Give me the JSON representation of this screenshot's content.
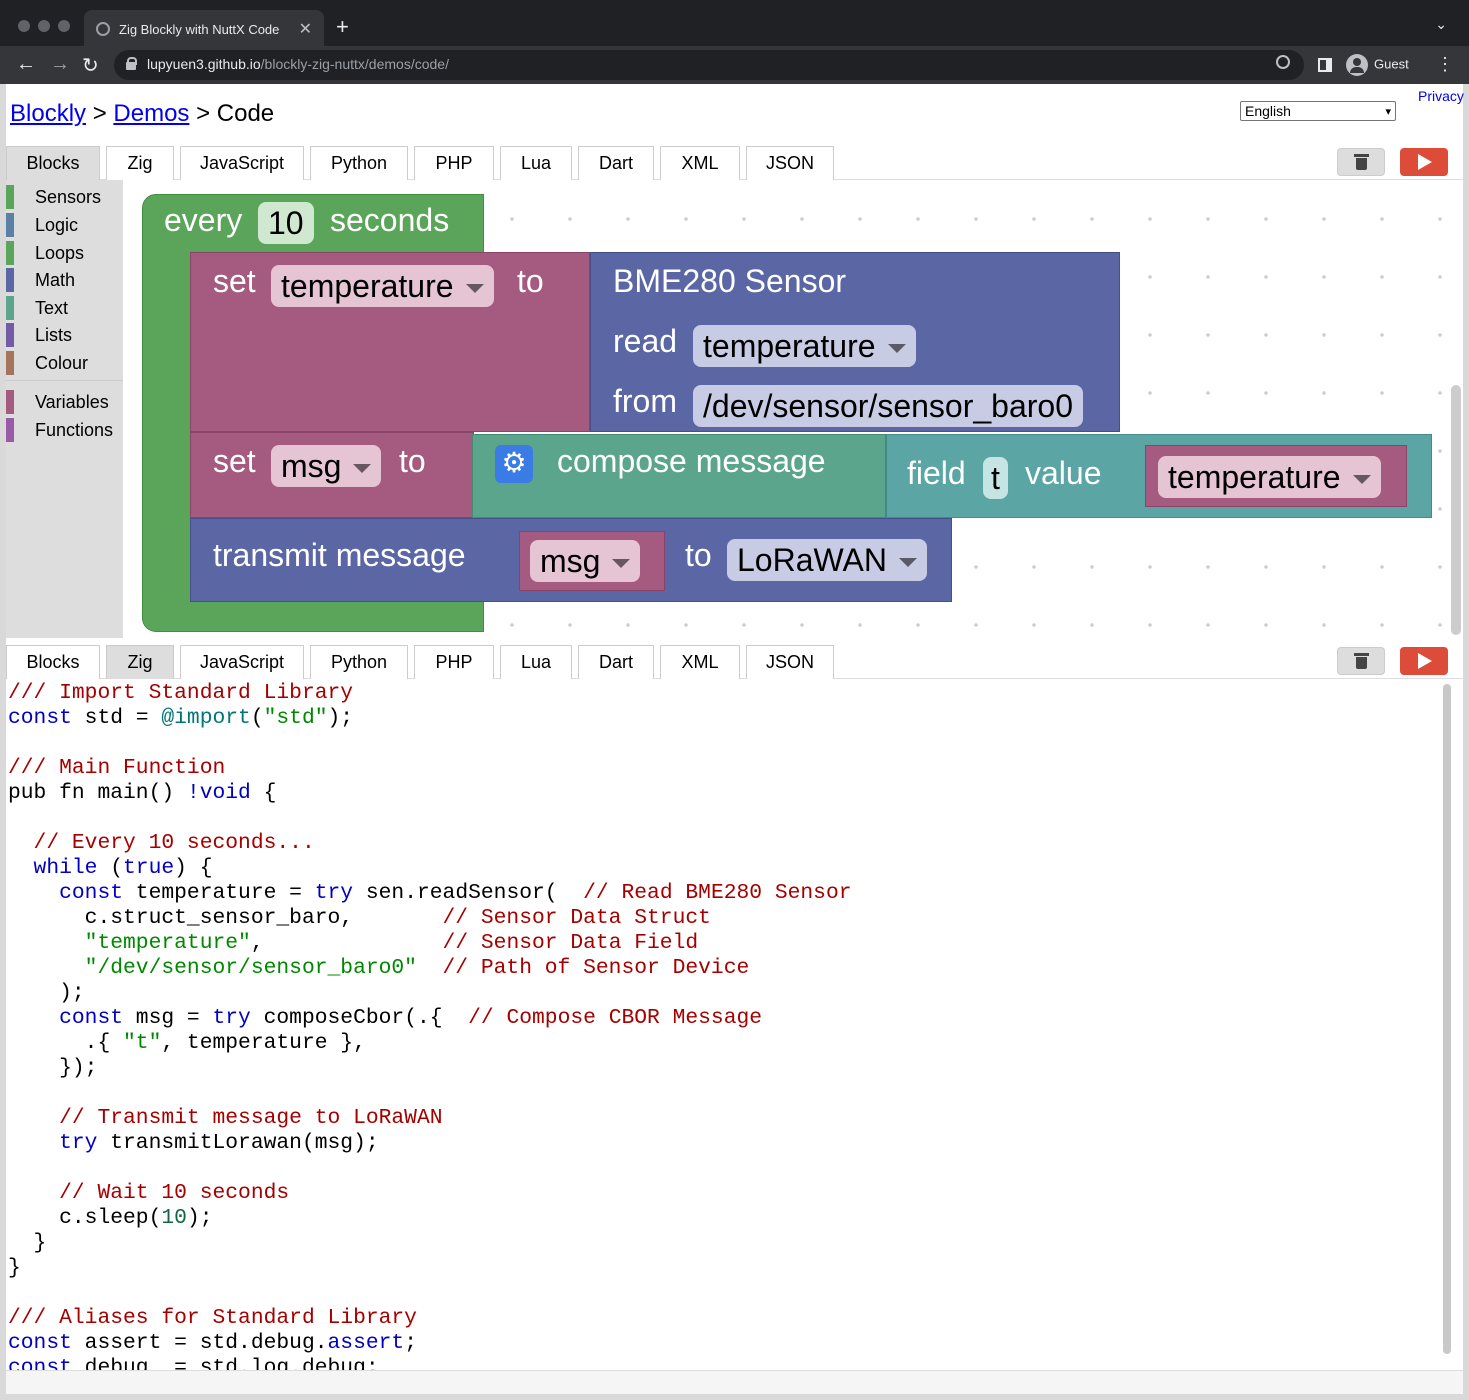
{
  "browser": {
    "tab_title": "Zig Blockly with NuttX Code",
    "tab_close": "✕",
    "new_tab": "+",
    "tab_menu": "⌄",
    "back": "←",
    "forward": "→",
    "reload": "↻",
    "url_host": "lupyuen3.github.io",
    "url_path": "/blockly-zig-nuttx/demos/code/",
    "profile": "Guest",
    "menu": "⋮"
  },
  "header": {
    "crumb1": "Blockly",
    "sep1": " > ",
    "crumb2": "Demos",
    "sep2": " > ",
    "crumb3": "Code",
    "language": "English",
    "privacy": "Privacy"
  },
  "tabs": [
    "Blocks",
    "Zig",
    "JavaScript",
    "Python",
    "PHP",
    "Lua",
    "Dart",
    "XML",
    "JSON"
  ],
  "toolbox": {
    "categories": [
      {
        "label": "Sensors",
        "color": "#5ba55b"
      },
      {
        "label": "Logic",
        "color": "#5b80a5"
      },
      {
        "label": "Loops",
        "color": "#5ba55b"
      },
      {
        "label": "Math",
        "color": "#5b67a5"
      },
      {
        "label": "Text",
        "color": "#5ba58c"
      },
      {
        "label": "Lists",
        "color": "#745ba5"
      },
      {
        "label": "Colour",
        "color": "#a5745b"
      },
      {
        "label": "Variables",
        "color": "#a55b80"
      },
      {
        "label": "Functions",
        "color": "#995ba5"
      }
    ]
  },
  "blocks": {
    "every": {
      "prefix": "every",
      "value": "10",
      "suffix": "seconds",
      "color": "#5ba55b"
    },
    "set_temp": {
      "set": "set",
      "var": "temperature",
      "to": "to",
      "color": "#a55b80"
    },
    "sensor": {
      "title": "BME280 Sensor",
      "read": "read",
      "read_value": "temperature",
      "from": "from",
      "from_value": "/dev/sensor/sensor_baro0",
      "color": "#5b67a5"
    },
    "set_msg": {
      "set": "set",
      "var": "msg",
      "to": "to"
    },
    "compose": {
      "label": "compose message",
      "color": "#5ba58c"
    },
    "field": {
      "field": "field",
      "name": "t",
      "value": "value",
      "var": "temperature",
      "color": "#5ba5a5"
    },
    "transmit": {
      "label": "transmit message",
      "var": "msg",
      "to": "to",
      "dest": "LoRaWAN"
    }
  },
  "code": {
    "l01": "/// Import Standard Library",
    "l02a": "const",
    "l02b": " std = ",
    "l02c": "@import",
    "l02d": "(",
    "l02e": "\"std\"",
    "l02f": ");",
    "l04": "/// Main Function",
    "l05a": "pub fn main",
    "l05b": "() ",
    "l05c": "!void",
    "l05d": " {",
    "l07": "  // Every 10 seconds...",
    "l08a": "  while",
    "l08b": " (",
    "l08c": "true",
    "l08d": ") {",
    "l09a": "    const",
    "l09b": " temperature = ",
    "l09c": "try",
    "l09d": " sen.readSensor(  ",
    "l09e": "// Read BME280 Sensor",
    "l10a": "      c.struct_sensor_baro,       ",
    "l10b": "// Sensor Data Struct",
    "l11a": "      \"temperature\"",
    "l11b": ",              ",
    "l11c": "// Sensor Data Field",
    "l12a": "      \"/dev/sensor/sensor_baro0\"",
    "l12b": "  ",
    "l12c": "// Path of Sensor Device",
    "l13": "    );",
    "l14a": "    const",
    "l14b": " msg = ",
    "l14c": "try",
    "l14d": " composeCbor(.{  ",
    "l14e": "// Compose CBOR Message",
    "l15a": "      .{ ",
    "l15b": "\"t\"",
    "l15c": ", temperature },",
    "l16": "    });",
    "l18": "    // Transmit message to LoRaWAN",
    "l19a": "    try",
    "l19b": " transmitLorawan(msg);",
    "l21": "    // Wait 10 seconds",
    "l22a": "    c.sleep(",
    "l22b": "10",
    "l22c": ");",
    "l23": "  }",
    "l24": "}",
    "l26": "/// Aliases for Standard Library",
    "l27a": "const",
    "l27b": " assert = std.debug.",
    "l27c": "assert",
    "l27d": ";",
    "l28a": "const",
    "l28b": " debug  = std.log.debug;"
  }
}
